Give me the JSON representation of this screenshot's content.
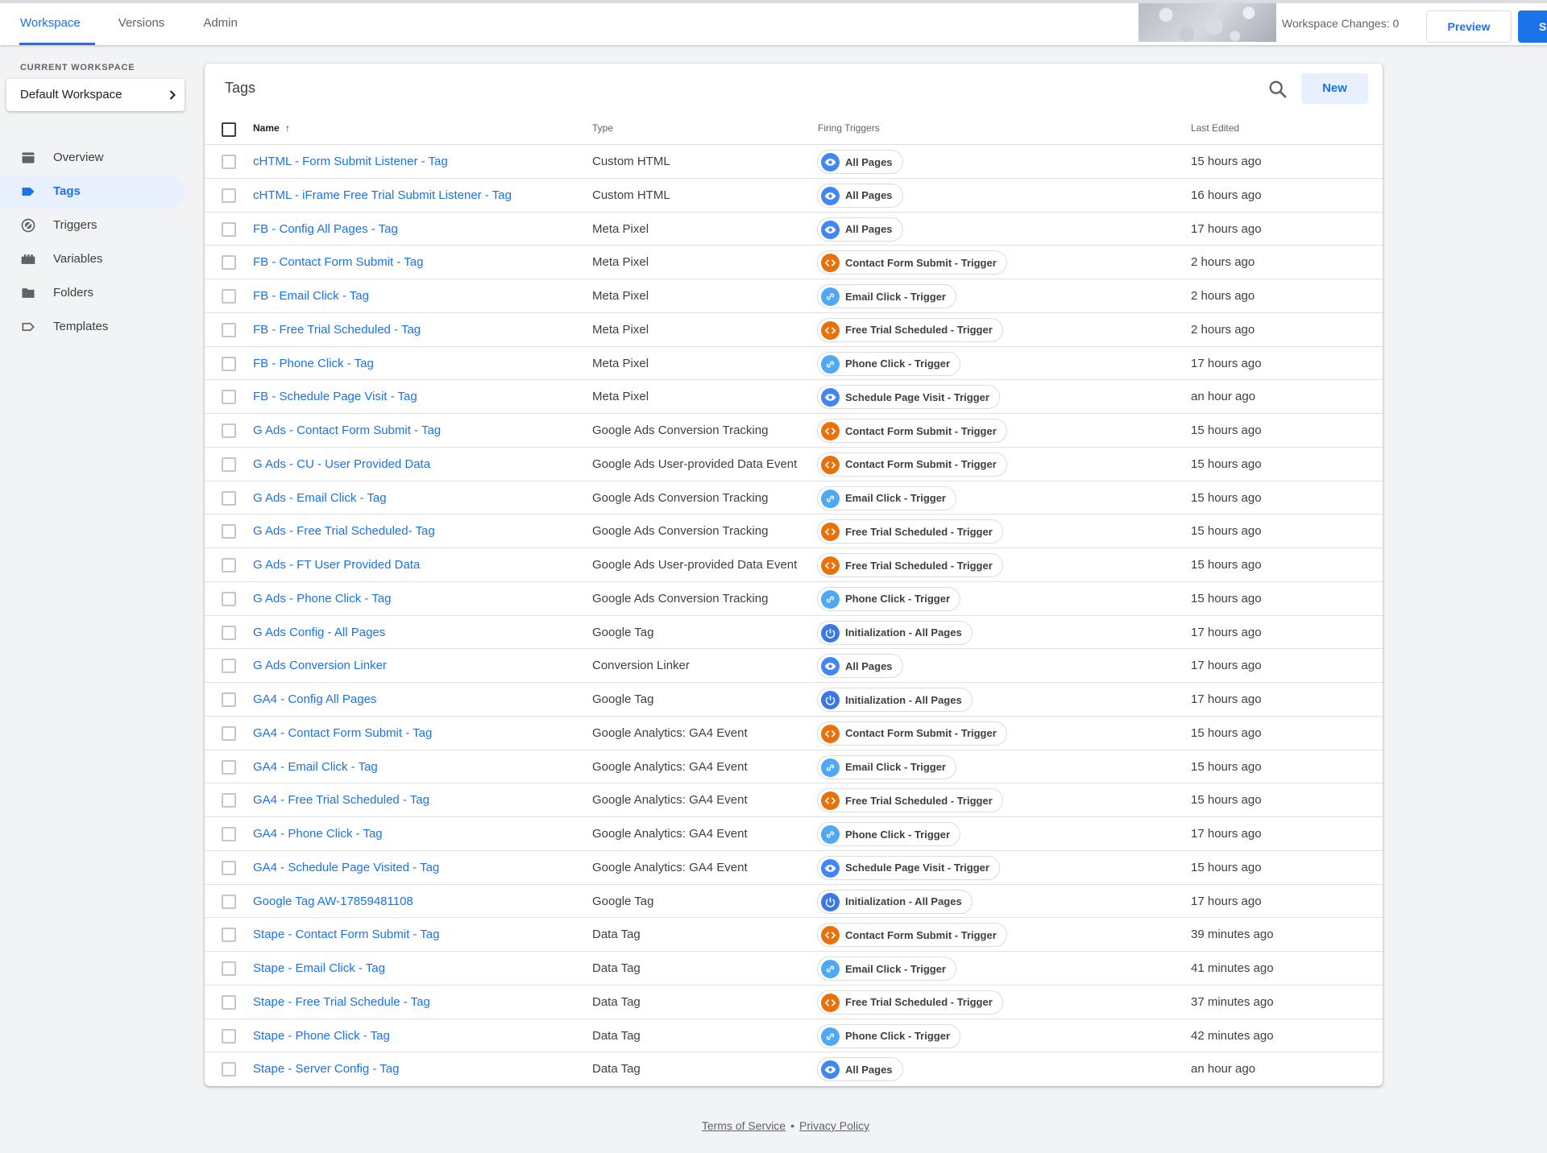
{
  "header": {
    "tabs": [
      {
        "label": "Workspace",
        "active": true
      },
      {
        "label": "Versions",
        "active": false
      },
      {
        "label": "Admin",
        "active": false
      }
    ],
    "workspace_changes": "Workspace Changes: 0",
    "preview_label": "Preview",
    "submit_label": "S"
  },
  "sidebar": {
    "current_workspace_label": "CURRENT WORKSPACE",
    "workspace_name": "Default Workspace",
    "items": [
      {
        "label": "Overview",
        "icon": "overview-icon",
        "active": false
      },
      {
        "label": "Tags",
        "icon": "tag-icon",
        "active": true
      },
      {
        "label": "Triggers",
        "icon": "trigger-icon",
        "active": false
      },
      {
        "label": "Variables",
        "icon": "variables-icon",
        "active": false
      },
      {
        "label": "Folders",
        "icon": "folder-icon",
        "active": false
      },
      {
        "label": "Templates",
        "icon": "template-icon",
        "active": false
      }
    ]
  },
  "main": {
    "title": "Tags",
    "new_label": "New",
    "columns": {
      "name": "Name",
      "sort_arrow": "↑",
      "type": "Type",
      "triggers": "Firing Triggers",
      "edited": "Last Edited"
    },
    "trigger_colors": {
      "pageview": "#4285f4",
      "custom": "#e8710a",
      "link": "#4ea8f3",
      "init": "#3b78e7"
    },
    "rows": [
      {
        "name": "cHTML - Form Submit Listener - Tag",
        "type": "Custom HTML",
        "trigger": "All Pages",
        "trigger_kind": "pageview",
        "edited": "15 hours ago"
      },
      {
        "name": "cHTML - iFrame Free Trial Submit Listener - Tag",
        "type": "Custom HTML",
        "trigger": "All Pages",
        "trigger_kind": "pageview",
        "edited": "16 hours ago"
      },
      {
        "name": "FB - Config All Pages - Tag",
        "type": "Meta Pixel",
        "trigger": "All Pages",
        "trigger_kind": "pageview",
        "edited": "17 hours ago"
      },
      {
        "name": "FB - Contact Form Submit - Tag",
        "type": "Meta Pixel",
        "trigger": "Contact Form Submit - Trigger",
        "trigger_kind": "custom",
        "edited": "2 hours ago"
      },
      {
        "name": "FB - Email Click - Tag",
        "type": "Meta Pixel",
        "trigger": "Email Click - Trigger",
        "trigger_kind": "link",
        "edited": "2 hours ago"
      },
      {
        "name": "FB - Free Trial Scheduled - Tag",
        "type": "Meta Pixel",
        "trigger": "Free Trial Scheduled - Trigger",
        "trigger_kind": "custom",
        "edited": "2 hours ago"
      },
      {
        "name": "FB - Phone Click - Tag",
        "type": "Meta Pixel",
        "trigger": "Phone Click - Trigger",
        "trigger_kind": "link",
        "edited": "17 hours ago"
      },
      {
        "name": "FB - Schedule Page Visit - Tag",
        "type": "Meta Pixel",
        "trigger": "Schedule Page Visit - Trigger",
        "trigger_kind": "pageview",
        "edited": "an hour ago"
      },
      {
        "name": "G Ads - Contact Form Submit - Tag",
        "type": "Google Ads Conversion Tracking",
        "trigger": "Contact Form Submit - Trigger",
        "trigger_kind": "custom",
        "edited": "15 hours ago"
      },
      {
        "name": "G Ads - CU - User Provided Data",
        "type": "Google Ads User-provided Data Event",
        "trigger": "Contact Form Submit - Trigger",
        "trigger_kind": "custom",
        "edited": "15 hours ago"
      },
      {
        "name": "G Ads - Email Click - Tag",
        "type": "Google Ads Conversion Tracking",
        "trigger": "Email Click - Trigger",
        "trigger_kind": "link",
        "edited": "15 hours ago"
      },
      {
        "name": "G Ads - Free Trial Scheduled- Tag",
        "type": "Google Ads Conversion Tracking",
        "trigger": "Free Trial Scheduled - Trigger",
        "trigger_kind": "custom",
        "edited": "15 hours ago"
      },
      {
        "name": "G Ads - FT User Provided Data",
        "type": "Google Ads User-provided Data Event",
        "trigger": "Free Trial Scheduled - Trigger",
        "trigger_kind": "custom",
        "edited": "15 hours ago"
      },
      {
        "name": "G Ads - Phone Click - Tag",
        "type": "Google Ads Conversion Tracking",
        "trigger": "Phone Click - Trigger",
        "trigger_kind": "link",
        "edited": "15 hours ago"
      },
      {
        "name": "G Ads Config - All Pages",
        "type": "Google Tag",
        "trigger": "Initialization - All Pages",
        "trigger_kind": "init",
        "edited": "17 hours ago"
      },
      {
        "name": "G Ads Conversion Linker",
        "type": "Conversion Linker",
        "trigger": "All Pages",
        "trigger_kind": "pageview",
        "edited": "17 hours ago"
      },
      {
        "name": "GA4 - Config All Pages",
        "type": "Google Tag",
        "trigger": "Initialization - All Pages",
        "trigger_kind": "init",
        "edited": "17 hours ago"
      },
      {
        "name": "GA4 - Contact Form Submit - Tag",
        "type": "Google Analytics: GA4 Event",
        "trigger": "Contact Form Submit - Trigger",
        "trigger_kind": "custom",
        "edited": "15 hours ago"
      },
      {
        "name": "GA4 - Email Click - Tag",
        "type": "Google Analytics: GA4 Event",
        "trigger": "Email Click - Trigger",
        "trigger_kind": "link",
        "edited": "15 hours ago"
      },
      {
        "name": "GA4 - Free Trial Scheduled - Tag",
        "type": "Google Analytics: GA4 Event",
        "trigger": "Free Trial Scheduled - Trigger",
        "trigger_kind": "custom",
        "edited": "15 hours ago"
      },
      {
        "name": "GA4 - Phone Click - Tag",
        "type": "Google Analytics: GA4 Event",
        "trigger": "Phone Click - Trigger",
        "trigger_kind": "link",
        "edited": "17 hours ago"
      },
      {
        "name": "GA4 - Schedule Page Visited - Tag",
        "type": "Google Analytics: GA4 Event",
        "trigger": "Schedule Page Visit - Trigger",
        "trigger_kind": "pageview",
        "edited": "15 hours ago"
      },
      {
        "name": "Google Tag AW-17859481108",
        "type": "Google Tag",
        "trigger": "Initialization - All Pages",
        "trigger_kind": "init",
        "edited": "17 hours ago"
      },
      {
        "name": "Stape - Contact Form Submit - Tag",
        "type": "Data Tag",
        "trigger": "Contact Form Submit - Trigger",
        "trigger_kind": "custom",
        "edited": "39 minutes ago"
      },
      {
        "name": "Stape - Email Click - Tag",
        "type": "Data Tag",
        "trigger": "Email Click - Trigger",
        "trigger_kind": "link",
        "edited": "41 minutes ago"
      },
      {
        "name": "Stape - Free Trial Schedule - Tag",
        "type": "Data Tag",
        "trigger": "Free Trial Scheduled - Trigger",
        "trigger_kind": "custom",
        "edited": "37 minutes ago"
      },
      {
        "name": "Stape - Phone Click - Tag",
        "type": "Data Tag",
        "trigger": "Phone Click - Trigger",
        "trigger_kind": "link",
        "edited": "42 minutes ago"
      },
      {
        "name": "Stape - Server Config - Tag",
        "type": "Data Tag",
        "trigger": "All Pages",
        "trigger_kind": "pageview",
        "edited": "an hour ago"
      }
    ]
  },
  "footer": {
    "terms": "Terms of Service",
    "separator": "•",
    "privacy": "Privacy Policy"
  }
}
